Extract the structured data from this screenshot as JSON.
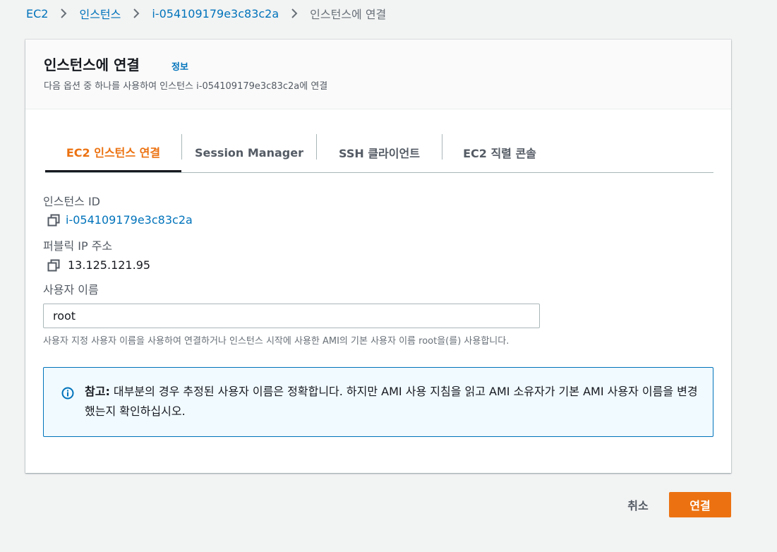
{
  "breadcrumb": {
    "items": [
      "EC2",
      "인스턴스",
      "i-054109179e3c83c2a"
    ],
    "current": "인스턴스에 연결"
  },
  "panel": {
    "title": "인스턴스에 연결",
    "info_link": "정보",
    "description": "다음 옵션 중 하나를 사용하여 인스턴스 i-054109179e3c83c2a에 연결"
  },
  "tabs": [
    {
      "label": "EC2 인스턴스 연결",
      "active": true
    },
    {
      "label": "Session Manager",
      "active": false
    },
    {
      "label": "SSH 클라이언트",
      "active": false
    },
    {
      "label": "EC2 직렬 콘솔",
      "active": false
    }
  ],
  "fields": {
    "instance_id_label": "인스턴스 ID",
    "instance_id_value": "i-054109179e3c83c2a",
    "public_ip_label": "퍼블릭 IP 주소",
    "public_ip_value": "13.125.121.95",
    "username_label": "사용자 이름",
    "username_value": "root",
    "username_help": "사용자 지정 사용자 이름을 사용하여 연결하거나 인스턴스 시작에 사용한 AMI의 기본 사용자 이름 root을(를) 사용합니다."
  },
  "alert": {
    "prefix": "참고:",
    "text": " 대부분의 경우 추정된 사용자 이름은 정확합니다. 하지만 AMI 사용 지침을 읽고 AMI 소유자가 기본 AMI 사용자 이름을 변경했는지 확인하십시오."
  },
  "actions": {
    "cancel_label": "취소",
    "connect_label": "연결"
  },
  "colors": {
    "accent": "#ec7211",
    "link": "#0073bb",
    "info_bg": "#f1faff"
  },
  "icons": [
    "chevron-right-icon",
    "copy-icon",
    "info-icon"
  ]
}
